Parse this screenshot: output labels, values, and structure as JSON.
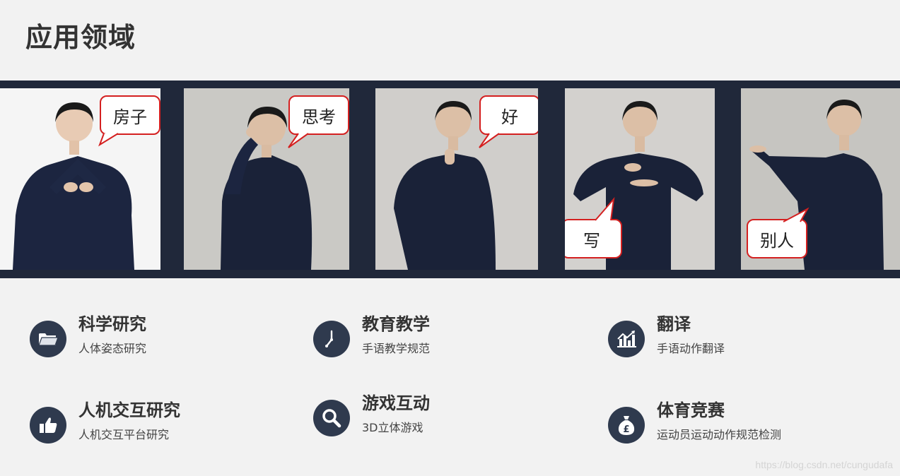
{
  "page": {
    "title": "应用领域"
  },
  "photos": [
    {
      "bubble": "房子",
      "bg": "#f4f4f4"
    },
    {
      "bubble": "思考",
      "bg": "#c9c8c4"
    },
    {
      "bubble": "好",
      "bg": "#cfcdca"
    },
    {
      "bubble": "写",
      "bg": "#d2d0cd"
    },
    {
      "bubble": "别人",
      "bg": "#c4c3bf"
    }
  ],
  "domains": [
    {
      "title": "科学研究",
      "desc": "人体姿态研究",
      "icon": "folder-icon"
    },
    {
      "title": "教育教学",
      "desc": "手语教学规范",
      "icon": "clock-icon"
    },
    {
      "title": "翻译",
      "desc": "手语动作翻译",
      "icon": "chart-icon"
    },
    {
      "title": "人机交互研究",
      "desc": "人机交互平台研究",
      "icon": "thumbs-up-icon"
    },
    {
      "title": "游戏互动",
      "desc": "3D立体游戏",
      "icon": "search-icon"
    },
    {
      "title": "体育竞赛",
      "desc": "运动员运动动作规范检测",
      "icon": "money-bag-icon"
    }
  ],
  "watermark": "https://blog.csdn.net/cungudafa",
  "colors": {
    "strip": "#20283a",
    "icon_circle": "#2f3a4e",
    "bubble_border": "#d42020",
    "background": "#f2f2f2"
  }
}
